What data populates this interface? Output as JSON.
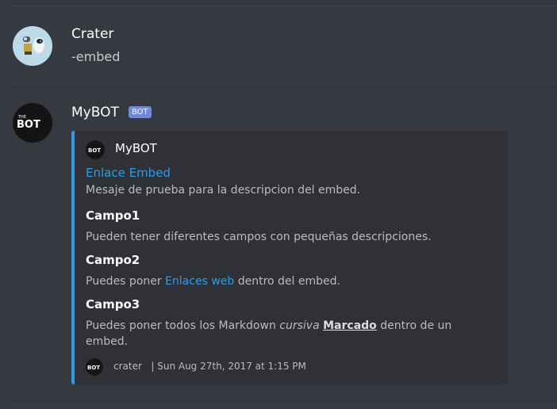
{
  "messages": [
    {
      "username": "Crater",
      "text": "-embed"
    },
    {
      "username": "MyBOT",
      "bot_tag": "BOT",
      "embed": {
        "author": "MyBOT",
        "title": "Enlace Embed",
        "description": "Mesaje de prueba para la descripcion del embed.",
        "fields": [
          {
            "name": "Campo1",
            "value": "Pueden tener diferentes campos con pequeñas descripciones."
          },
          {
            "name": "Campo2",
            "value_before": "Puedes poner ",
            "value_link": "Enlaces web",
            "value_after": " dentro del embed."
          },
          {
            "name": "Campo3",
            "value_before": "Puedes poner todos los Markdown ",
            "value_italic": "cursiva",
            "value_space": " ",
            "value_bold": "Marcado",
            "value_after": " dentro de un embed."
          }
        ],
        "footer": {
          "name": "crater",
          "timestamp": "| Sun Aug 27th, 2017 at 1:15 PM"
        }
      }
    }
  ],
  "colors": {
    "background": "#36393f",
    "embed_background": "#2f3136",
    "embed_accent": "#2b9de6",
    "bot_tag": "#7289da"
  },
  "icons": {
    "crater_avatar": "robot-avatar-icon",
    "bot_avatar": "bot-logo-icon"
  }
}
